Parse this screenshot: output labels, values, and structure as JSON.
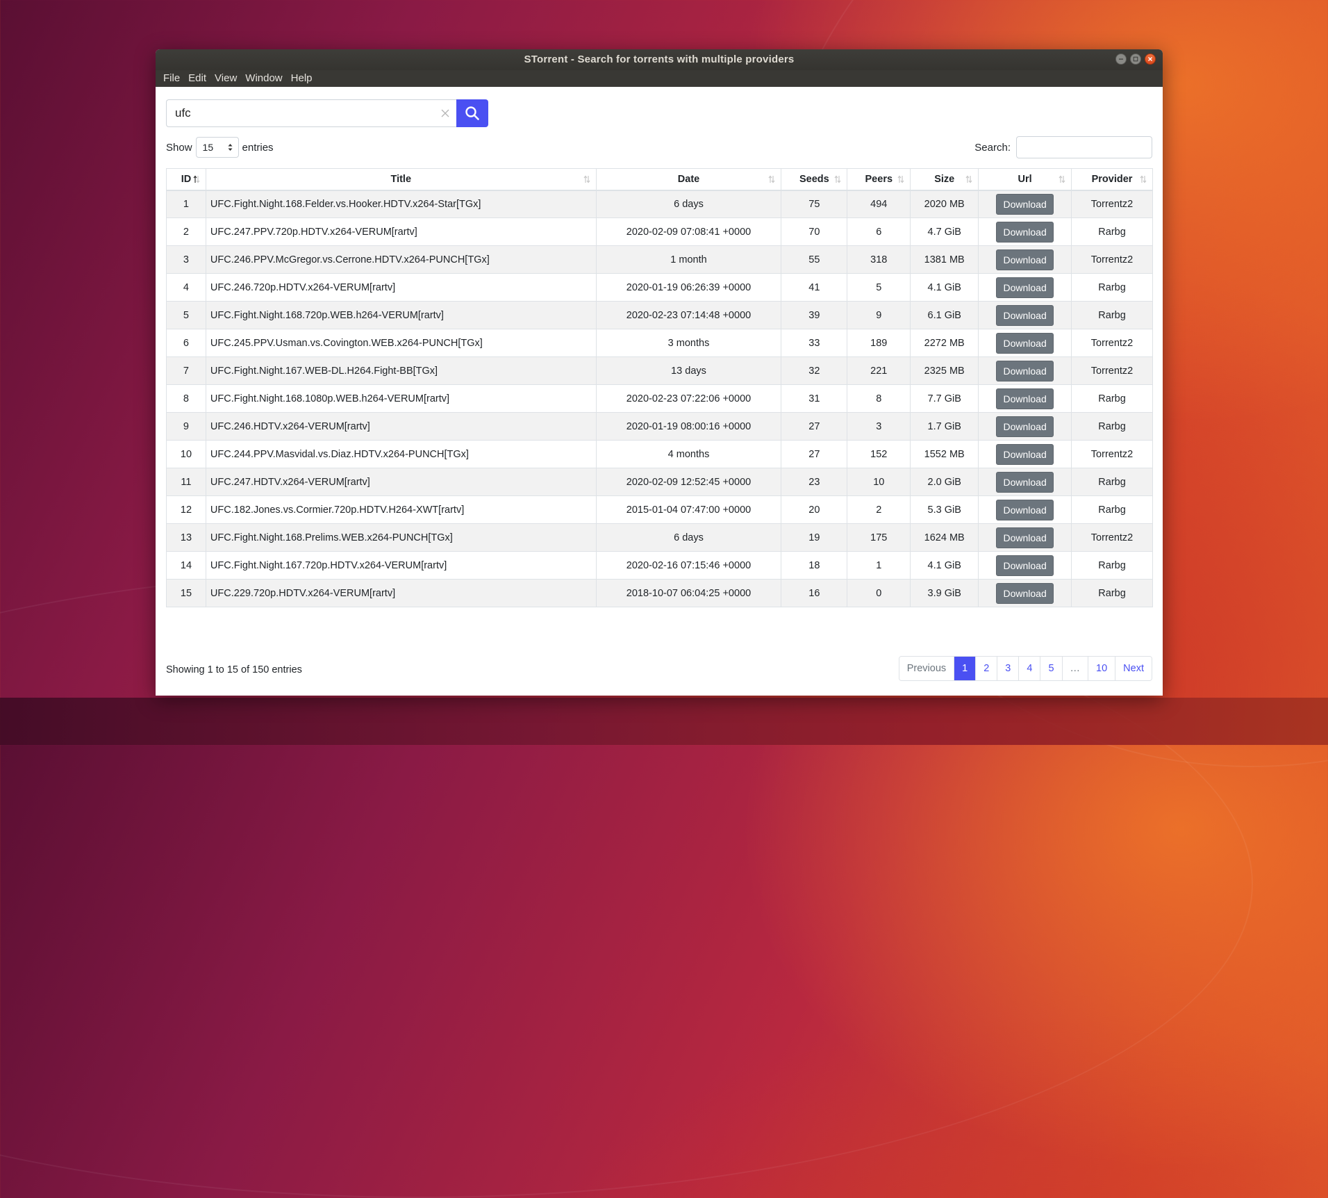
{
  "window": {
    "title": "STorrent - Search for torrents with multiple providers"
  },
  "menu": [
    "File",
    "Edit",
    "View",
    "Window",
    "Help"
  ],
  "search": {
    "value": "ufc"
  },
  "length_menu": {
    "prefix": "Show",
    "value": "15",
    "suffix": "entries"
  },
  "filter": {
    "label": "Search:",
    "value": ""
  },
  "columns": [
    "ID",
    "Title",
    "Date",
    "Seeds",
    "Peers",
    "Size",
    "Url",
    "Provider"
  ],
  "download_label": "Download",
  "rows": [
    {
      "id": "1",
      "title": "UFC.Fight.Night.168.Felder.vs.Hooker.HDTV.x264-Star[TGx]",
      "date": "6 days",
      "seeds": "75",
      "peers": "494",
      "size": "2020 MB",
      "provider": "Torrentz2"
    },
    {
      "id": "2",
      "title": "UFC.247.PPV.720p.HDTV.x264-VERUM[rartv]",
      "date": "2020-02-09 07:08:41 +0000",
      "seeds": "70",
      "peers": "6",
      "size": "4.7 GiB",
      "provider": "Rarbg"
    },
    {
      "id": "3",
      "title": "UFC.246.PPV.McGregor.vs.Cerrone.HDTV.x264-PUNCH[TGx]",
      "date": "1 month",
      "seeds": "55",
      "peers": "318",
      "size": "1381 MB",
      "provider": "Torrentz2"
    },
    {
      "id": "4",
      "title": "UFC.246.720p.HDTV.x264-VERUM[rartv]",
      "date": "2020-01-19 06:26:39 +0000",
      "seeds": "41",
      "peers": "5",
      "size": "4.1 GiB",
      "provider": "Rarbg"
    },
    {
      "id": "5",
      "title": "UFC.Fight.Night.168.720p.WEB.h264-VERUM[rartv]",
      "date": "2020-02-23 07:14:48 +0000",
      "seeds": "39",
      "peers": "9",
      "size": "6.1 GiB",
      "provider": "Rarbg"
    },
    {
      "id": "6",
      "title": "UFC.245.PPV.Usman.vs.Covington.WEB.x264-PUNCH[TGx]",
      "date": "3 months",
      "seeds": "33",
      "peers": "189",
      "size": "2272 MB",
      "provider": "Torrentz2"
    },
    {
      "id": "7",
      "title": "UFC.Fight.Night.167.WEB-DL.H264.Fight-BB[TGx]",
      "date": "13 days",
      "seeds": "32",
      "peers": "221",
      "size": "2325 MB",
      "provider": "Torrentz2"
    },
    {
      "id": "8",
      "title": "UFC.Fight.Night.168.1080p.WEB.h264-VERUM[rartv]",
      "date": "2020-02-23 07:22:06 +0000",
      "seeds": "31",
      "peers": "8",
      "size": "7.7 GiB",
      "provider": "Rarbg"
    },
    {
      "id": "9",
      "title": "UFC.246.HDTV.x264-VERUM[rartv]",
      "date": "2020-01-19 08:00:16 +0000",
      "seeds": "27",
      "peers": "3",
      "size": "1.7 GiB",
      "provider": "Rarbg"
    },
    {
      "id": "10",
      "title": "UFC.244.PPV.Masvidal.vs.Diaz.HDTV.x264-PUNCH[TGx]",
      "date": "4 months",
      "seeds": "27",
      "peers": "152",
      "size": "1552 MB",
      "provider": "Torrentz2"
    },
    {
      "id": "11",
      "title": "UFC.247.HDTV.x264-VERUM[rartv]",
      "date": "2020-02-09 12:52:45 +0000",
      "seeds": "23",
      "peers": "10",
      "size": "2.0 GiB",
      "provider": "Rarbg"
    },
    {
      "id": "12",
      "title": "UFC.182.Jones.vs.Cormier.720p.HDTV.H264-XWT[rartv]",
      "date": "2015-01-04 07:47:00 +0000",
      "seeds": "20",
      "peers": "2",
      "size": "5.3 GiB",
      "provider": "Rarbg"
    },
    {
      "id": "13",
      "title": "UFC.Fight.Night.168.Prelims.WEB.x264-PUNCH[TGx]",
      "date": "6 days",
      "seeds": "19",
      "peers": "175",
      "size": "1624 MB",
      "provider": "Torrentz2"
    },
    {
      "id": "14",
      "title": "UFC.Fight.Night.167.720p.HDTV.x264-VERUM[rartv]",
      "date": "2020-02-16 07:15:46 +0000",
      "seeds": "18",
      "peers": "1",
      "size": "4.1 GiB",
      "provider": "Rarbg"
    },
    {
      "id": "15",
      "title": "UFC.229.720p.HDTV.x264-VERUM[rartv]",
      "date": "2018-10-07 06:04:25 +0000",
      "seeds": "16",
      "peers": "0",
      "size": "3.9 GiB",
      "provider": "Rarbg"
    }
  ],
  "info": "Showing 1 to 15 of 150 entries",
  "pagination": {
    "previous": "Previous",
    "pages": [
      "1",
      "2",
      "3",
      "4",
      "5",
      "…",
      "10"
    ],
    "active": "1",
    "next": "Next"
  },
  "colors": {
    "accent": "#4a50f2",
    "download_button": "#6c757d",
    "titlebar": "#3e3d39"
  },
  "icons": {
    "search_button": "search-icon",
    "clear": "close-icon",
    "sort": "sort-icon"
  }
}
